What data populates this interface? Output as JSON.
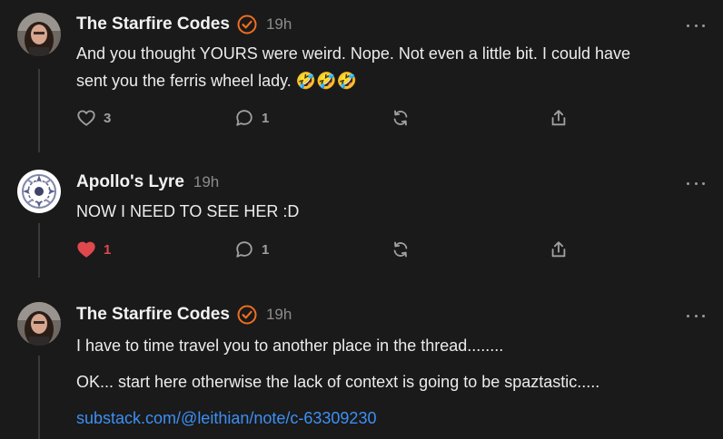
{
  "comments": [
    {
      "author": "The Starfire Codes",
      "verified": true,
      "time": "19h",
      "text_lines": [
        "And you thought YOURS were weird. Nope. Not even a little bit. I could have",
        "sent you the ferris wheel lady. 🤣🤣🤣"
      ],
      "likes": "3",
      "liked": false,
      "replies": "1"
    },
    {
      "author": "Apollo's Lyre",
      "verified": false,
      "time": "19h",
      "text_lines": [
        "NOW I NEED TO SEE HER :D"
      ],
      "likes": "1",
      "liked": true,
      "replies": "1"
    },
    {
      "author": "The Starfire Codes",
      "verified": true,
      "time": "19h",
      "paragraphs": [
        "I have to time travel you to another place in the thread........",
        "OK... start here otherwise the lack of context is going to be spaztastic....."
      ],
      "link": "substack.com/@leithian/note/c-63309230"
    }
  ],
  "colors": {
    "background": "#1a1a1a",
    "verified_badge": "#f06d21",
    "liked_heart": "#e0484d",
    "link": "#3d8ff4"
  },
  "icons": [
    "heart-icon",
    "comment-icon",
    "restack-icon",
    "share-icon",
    "more-icon",
    "verified-icon"
  ]
}
